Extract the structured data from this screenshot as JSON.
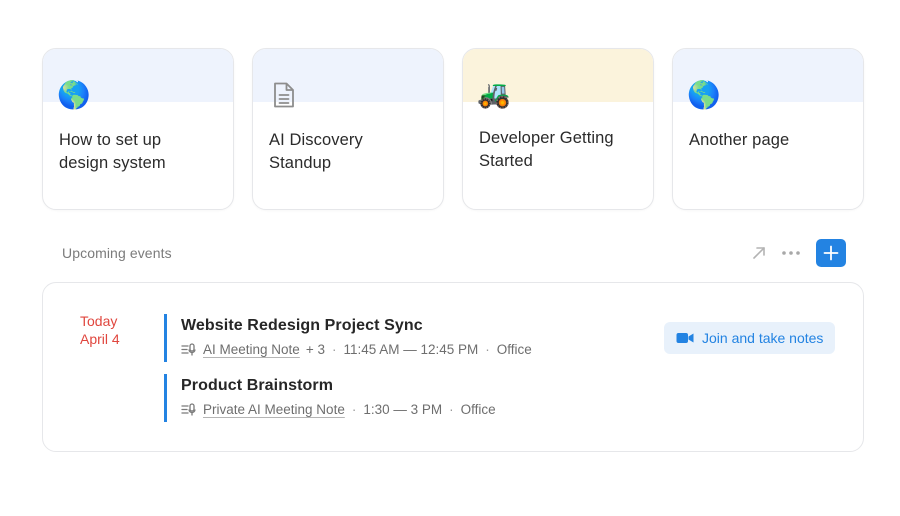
{
  "cards": [
    {
      "title": "How to set up design system",
      "icon": "globe-icon",
      "glyph": "🌎"
    },
    {
      "title": "AI Discovery Standup",
      "icon": "document-icon",
      "glyph": ""
    },
    {
      "title": "Developer Getting Started",
      "icon": "tractor-icon",
      "glyph": "🚜"
    },
    {
      "title": "Another page",
      "icon": "globe-icon",
      "glyph": "🌎"
    }
  ],
  "events_section": {
    "title": "Upcoming events",
    "actions": [
      "open-arrow-icon",
      "more-icon",
      "add-icon"
    ]
  },
  "events": {
    "date_label": "Today",
    "date_value": "April 4",
    "items": [
      {
        "title": "Website Redesign Project Sync",
        "note_link": "AI Meeting Note",
        "extra": "+ 3",
        "time": "11:45 AM — 12:45 PM",
        "location": "Office"
      },
      {
        "title": "Product Brainstorm",
        "note_link": "Private AI Meeting Note",
        "time": "1:30 — 3 PM",
        "location": "Office"
      }
    ],
    "join_button": "Join and take notes"
  },
  "colors": {
    "accent": "#2383e2",
    "date_red": "#e0463e",
    "card_band_blue": "#eef3fd",
    "card_band_yellow": "#fbf3dc"
  }
}
